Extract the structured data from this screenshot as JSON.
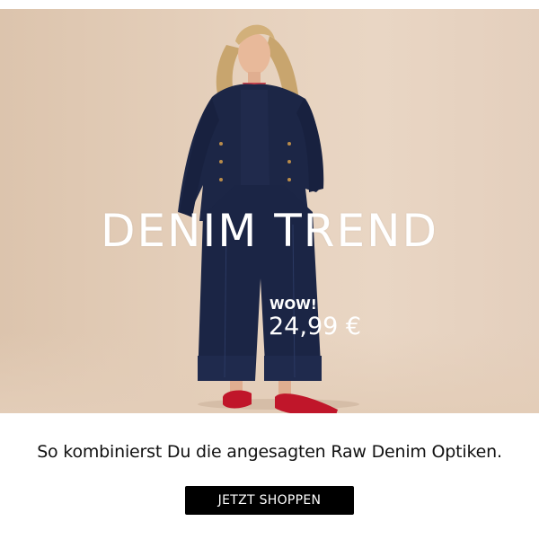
{
  "hero": {
    "headline": "DENIM TREND",
    "badge": "WOW!",
    "price": "24,99 €"
  },
  "body": {
    "subline": "So kombinierst Du die angesagten Raw Denim Optiken."
  },
  "cta": {
    "label": "JETZT SHOPPEN"
  },
  "colors": {
    "background": "#e6d1bd",
    "denim": "#1c2646",
    "shoes": "#c0162a",
    "button": "#000000",
    "text": "#111111"
  }
}
